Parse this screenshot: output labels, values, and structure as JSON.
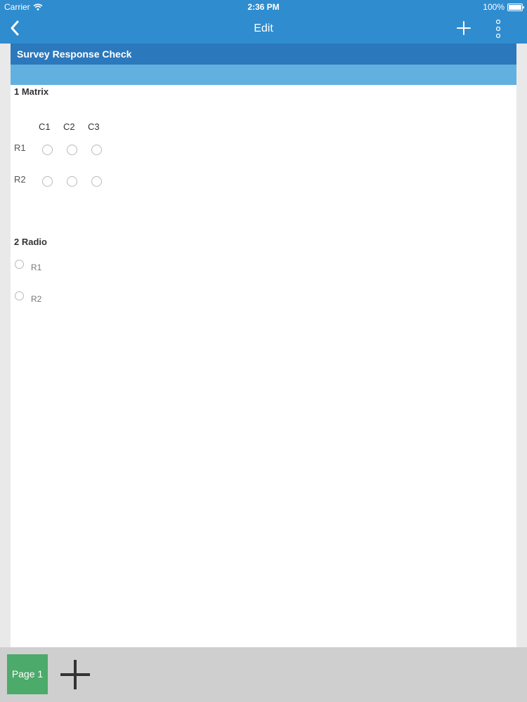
{
  "status_bar": {
    "carrier": "Carrier",
    "time": "2:36 PM",
    "battery": "100%"
  },
  "nav": {
    "title": "Edit",
    "back_icon": "chevron-left-icon",
    "add_icon": "plus-icon",
    "more_icon": "vertical-dots-icon"
  },
  "survey": {
    "title": "Survey Response Check",
    "questions": [
      {
        "label": "1 Matrix",
        "columns": [
          "C1",
          "C2",
          "C3"
        ],
        "rows": [
          "R1",
          "R2"
        ]
      },
      {
        "label": "2 Radio",
        "options": [
          "R1",
          "R2"
        ]
      }
    ]
  },
  "bottom": {
    "page_tab": "Page 1",
    "add_page_icon": "plus-icon"
  },
  "colors": {
    "nav": "#2f8ccf",
    "title_bar": "#2b78bc",
    "sub_bar": "#62b0e0",
    "page_tab": "#4caa6a"
  }
}
